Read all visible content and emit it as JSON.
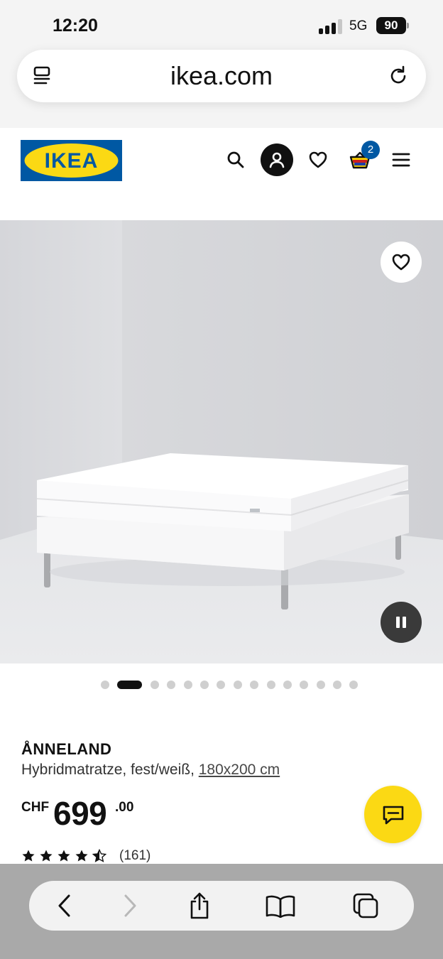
{
  "status_bar": {
    "time": "12:20",
    "network": "5G",
    "battery": "90"
  },
  "browser": {
    "url": "ikea.com"
  },
  "header": {
    "logo_text": "IKEA",
    "cart_count": "2"
  },
  "product": {
    "name": "ÅNNELAND",
    "description": "Hybridmatratze, fest/weiß,",
    "size": "180x200 cm",
    "price_currency": "CHF",
    "price_main": "699",
    "price_decimals": ".00",
    "rating_value": 4.5,
    "rating_max": 5,
    "review_count": "(161)"
  },
  "carousel": {
    "total_images": 15,
    "active_index": 1
  },
  "colors": {
    "ikea_blue": "#0058a3",
    "ikea_yellow": "#fbd914",
    "text": "#111111"
  },
  "icons": {
    "browser_menu": "reader-menu-icon",
    "reload": "reload-icon",
    "search": "search-icon",
    "account": "account-icon",
    "wishlist": "heart-icon",
    "cart": "shopping-bag-icon",
    "menu": "hamburger-menu-icon",
    "chat": "chat-icon",
    "pause": "pause-icon",
    "back": "back-chevron-icon",
    "forward": "forward-chevron-icon",
    "share": "share-icon",
    "bookmarks": "book-icon",
    "tabs": "tabs-icon"
  }
}
